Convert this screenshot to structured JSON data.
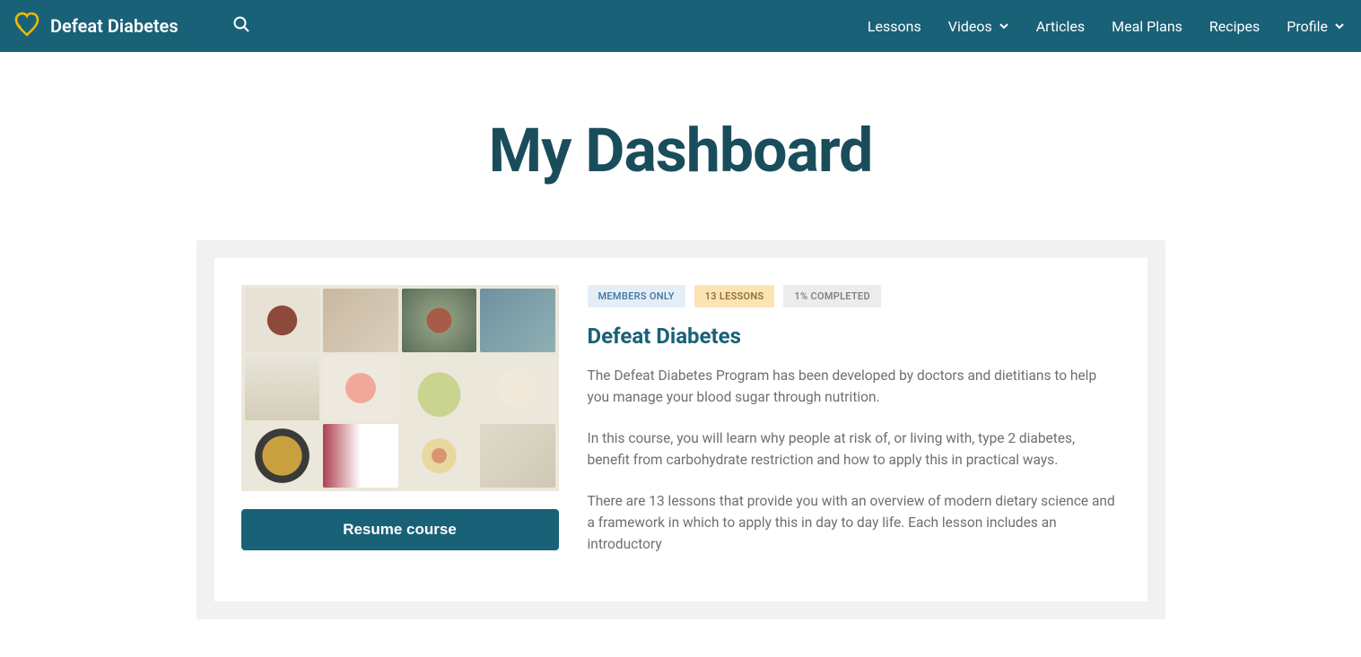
{
  "brand": "Defeat Diabetes",
  "nav": {
    "lessons": "Lessons",
    "videos": "Videos",
    "articles": "Articles",
    "mealplans": "Meal Plans",
    "recipes": "Recipes",
    "profile": "Profile"
  },
  "page_title": "My Dashboard",
  "course": {
    "badges": {
      "members": "MEMBERS ONLY",
      "lessons": "13 LESSONS",
      "completed": "1% COMPLETED"
    },
    "title": "Defeat Diabetes",
    "desc1": "The Defeat Diabetes Program has been developed by doctors and dietitians to help you manage your blood sugar through nutrition.",
    "desc2": "In this course, you will learn why people at risk of, or living with, type 2 diabetes, benefit from carbohydrate restriction and how to apply this in practical ways.",
    "desc3": "There are 13 lessons that provide you with an overview of modern dietary science and a framework in which to apply this in day to day life. Each lesson includes an introductory",
    "resume": "Resume course"
  }
}
